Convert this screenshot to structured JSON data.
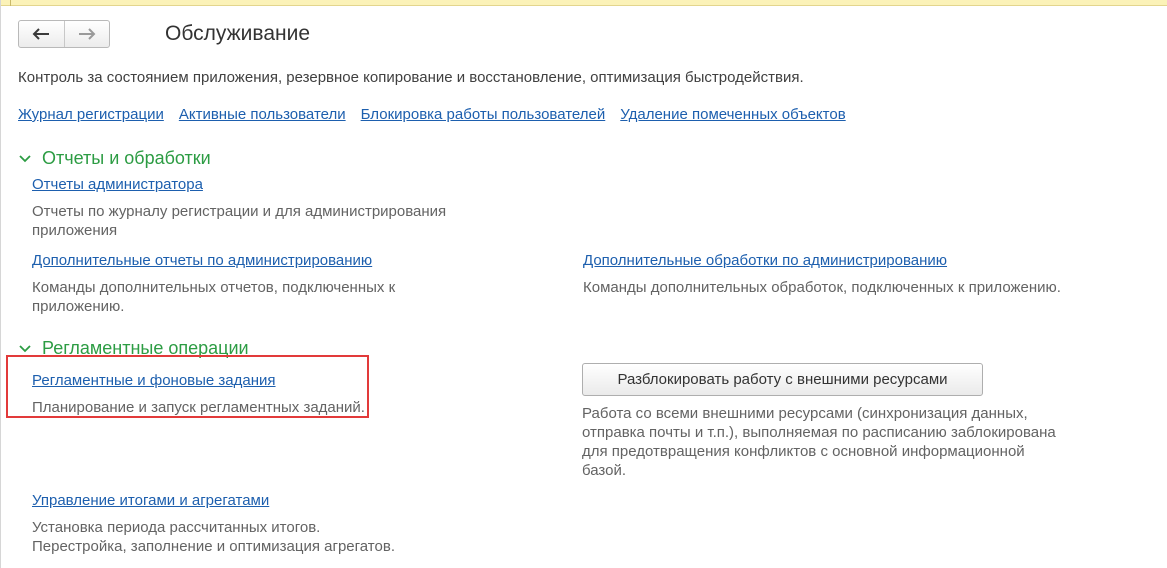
{
  "title": "Обслуживание",
  "description": "Контроль за состоянием приложения, резервное копирование и восстановление, оптимизация быстродействия.",
  "top_links": [
    "Журнал регистрации",
    "Активные пользователи",
    "Блокировка работы пользователей",
    "Удаление помеченных объектов"
  ],
  "sections": {
    "reports": {
      "title": "Отчеты и обработки",
      "admin_reports": {
        "label": "Отчеты администратора",
        "hint_line1": "Отчеты по журналу регистрации и для администрирования",
        "hint_line2": "приложения"
      },
      "extra_reports": {
        "label": "Дополнительные отчеты по администрированию",
        "hint_line1": "Команды дополнительных отчетов, подключенных к",
        "hint_line2": "приложению."
      },
      "extra_processors": {
        "label": "Дополнительные обработки по администрированию",
        "hint_line1": "Команды дополнительных обработок, подключенных к приложению."
      }
    },
    "scheduled": {
      "title": "Регламентные операции",
      "jobs": {
        "label": "Регламентные и фоновые задания",
        "hint_line1": "Планирование и запуск регламентных заданий."
      },
      "unlock": {
        "button_label": "Разблокировать работу с внешними ресурсами",
        "hint_line1": "Работа со всеми внешними ресурсами (синхронизация данных,",
        "hint_line2": "отправка почты и т.п.), выполняемая по расписанию заблокирована",
        "hint_line3": "для предотвращения конфликтов с основной информационной",
        "hint_line4": "базой."
      },
      "totals": {
        "label": "Управление итогами и агрегатами",
        "hint_line1": "Установка периода рассчитанных итогов.",
        "hint_line2": "Перестройка, заполнение и оптимизация агрегатов."
      }
    }
  },
  "colors": {
    "link": "#1d5fae",
    "section_title": "#2c9c43",
    "highlight": "#e23a3a"
  },
  "icons": {
    "back": "arrow-left-icon",
    "forward": "arrow-right-icon",
    "collapse": "chevron-down-icon"
  }
}
